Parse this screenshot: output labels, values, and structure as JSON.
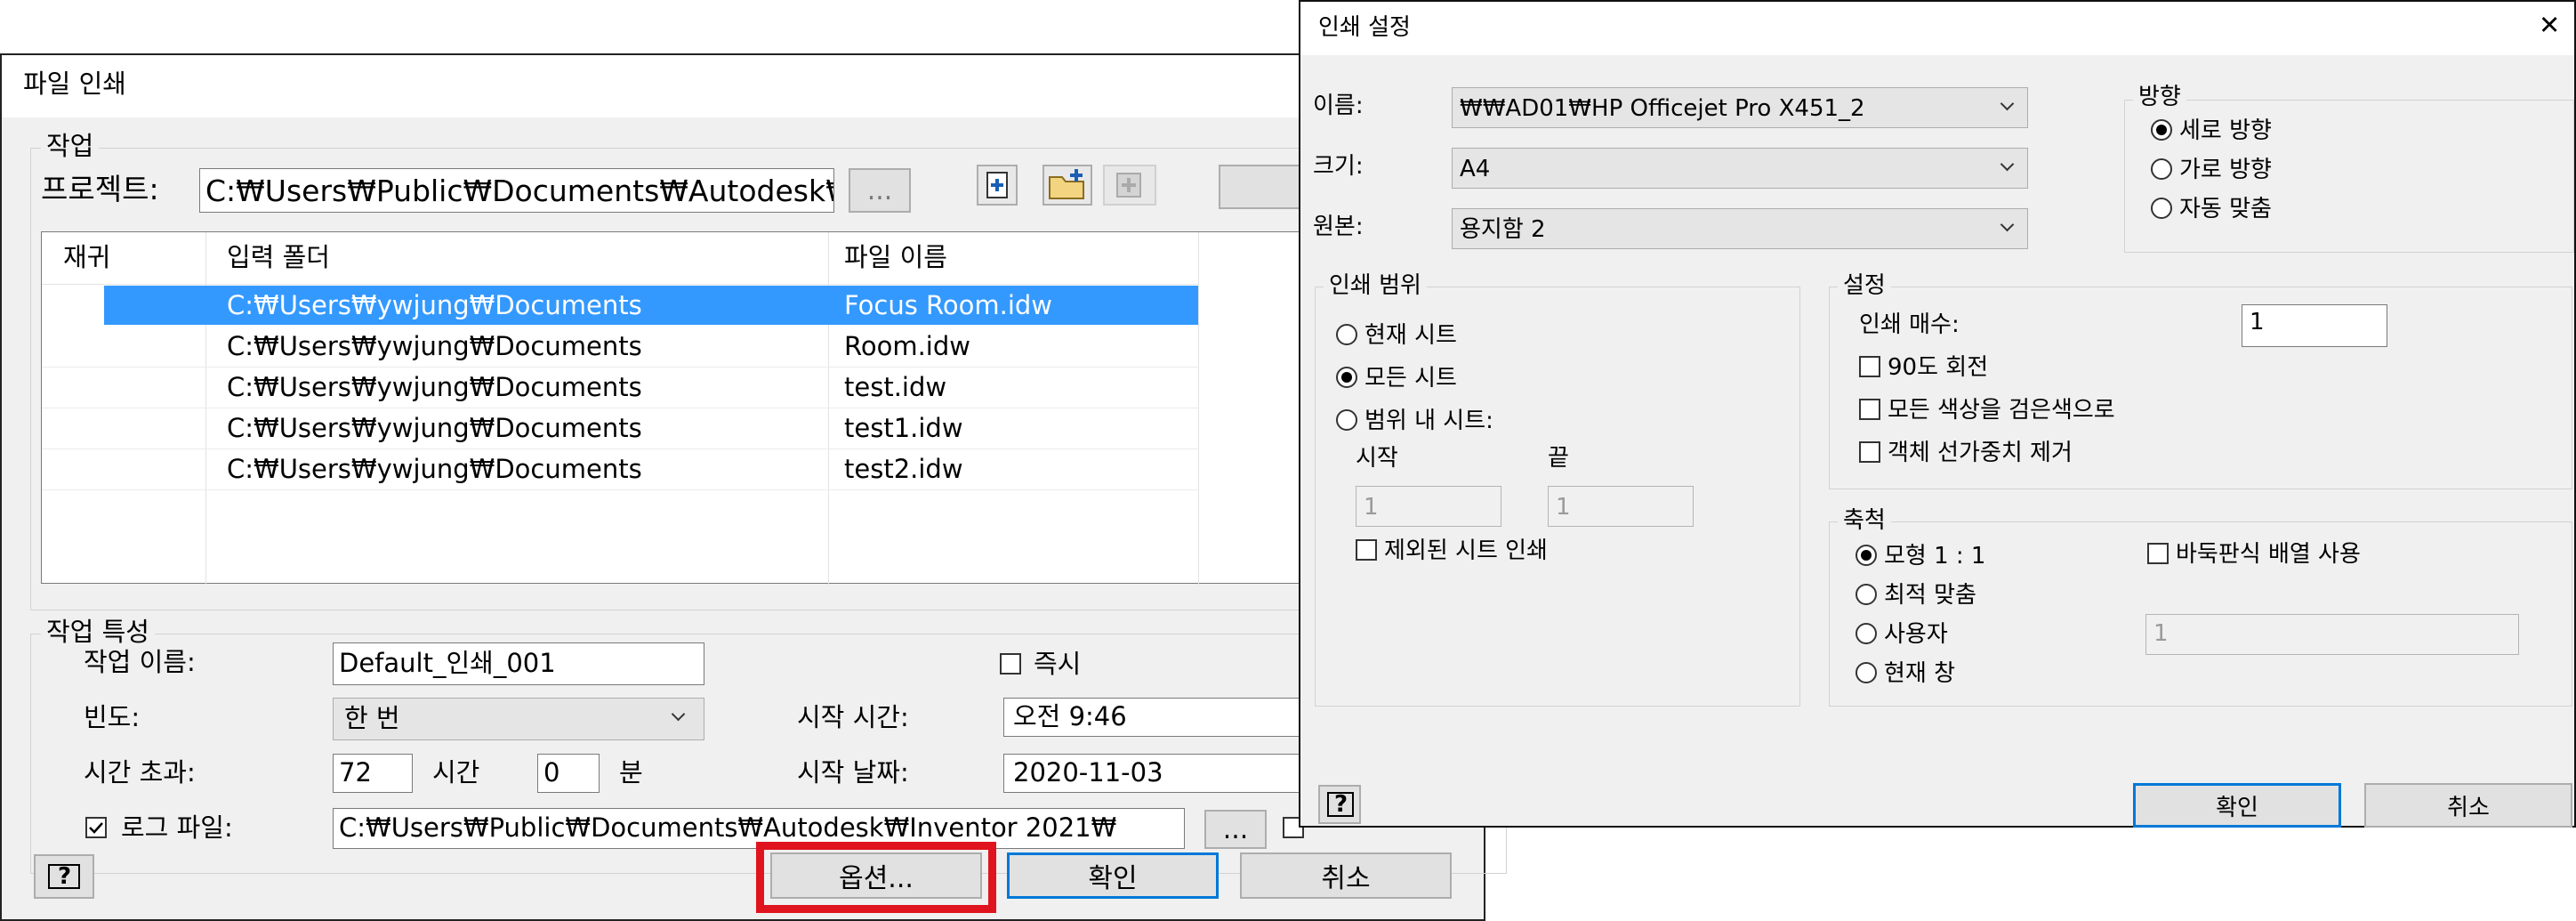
{
  "print_dialog": {
    "title": "파일 인쇄",
    "job_group_label": "작업",
    "project_label": "프로젝트:",
    "project_path": "C:₩Users₩Public₩Documents₩Autodesk₩",
    "browse_label": "...",
    "columns": [
      "재귀",
      "입력 폴더",
      "파일 이름"
    ],
    "rows": [
      {
        "recursive": "",
        "folder": "C:₩Users₩ywjung₩Documents",
        "file": "Focus Room.idw",
        "selected": true
      },
      {
        "recursive": "",
        "folder": "C:₩Users₩ywjung₩Documents",
        "file": "Room.idw",
        "selected": false
      },
      {
        "recursive": "",
        "folder": "C:₩Users₩ywjung₩Documents",
        "file": "test.idw",
        "selected": false
      },
      {
        "recursive": "",
        "folder": "C:₩Users₩ywjung₩Documents",
        "file": "test1.idw",
        "selected": false
      },
      {
        "recursive": "",
        "folder": "C:₩Users₩ywjung₩Documents",
        "file": "test2.idw",
        "selected": false
      }
    ],
    "props_group_label": "작업 특성",
    "job_name_label": "작업 이름:",
    "job_name_value": "Default_인쇄_001",
    "immediate_label": "즉시",
    "frequency_label": "빈도:",
    "frequency_value": "한 번",
    "start_time_label": "시작 시간:",
    "start_time_value": "오전   9:46",
    "timeout_label": "시간 초과:",
    "timeout_hours": "72",
    "hours_unit": "시간",
    "timeout_minutes": "0",
    "minutes_unit": "분",
    "start_date_label": "시작 날짜:",
    "start_date_value": "2020-11-03",
    "log_file_label": "로그 파일:",
    "log_file_path": "C:₩Users₩Public₩Documents₩Autodesk₩Inventor 2021₩",
    "log_checked": true,
    "help_label": "?",
    "options_label": "옵션...",
    "ok_label": "확인",
    "cancel_label": "취소",
    "highlight_color": "#e0141e",
    "selection_color": "#3399ff"
  },
  "print_settings": {
    "title": "인쇄 설정",
    "close_label": "✕",
    "name_label": "이름:",
    "name_value": "₩₩AD01₩HP Officejet Pro X451_2",
    "size_label": "크기:",
    "size_value": "A4",
    "source_label": "원본:",
    "source_value": "용지함 2",
    "orientation_label": "방향",
    "orientation_options": [
      "세로 방향",
      "가로 방향",
      "자동 맞춤"
    ],
    "orientation_selected": 0,
    "range_label": "인쇄 범위",
    "range_options": [
      "현재 시트",
      "모든 시트",
      "범위 내 시트:"
    ],
    "range_selected": 1,
    "start_label": "시작",
    "end_label": "끝",
    "start_value": "1",
    "end_value": "1",
    "exclude_label": "제외된 시트 인쇄",
    "settings_label": "설정",
    "copies_label": "인쇄 매수:",
    "copies_value": "1",
    "rotate_label": "90도 회전",
    "black_label": "모든 색상을 검은색으로",
    "lineweight_label": "객체 선가중치 제거",
    "scale_label": "축척",
    "scale_options": [
      "모형 1 : 1",
      "최적 맞춤",
      "사용자",
      "현재 창"
    ],
    "scale_selected": 0,
    "tile_label": "바둑판식 배열 사용",
    "custom_value": "1",
    "help_label": "?",
    "ok_label": "확인",
    "cancel_label": "취소"
  }
}
